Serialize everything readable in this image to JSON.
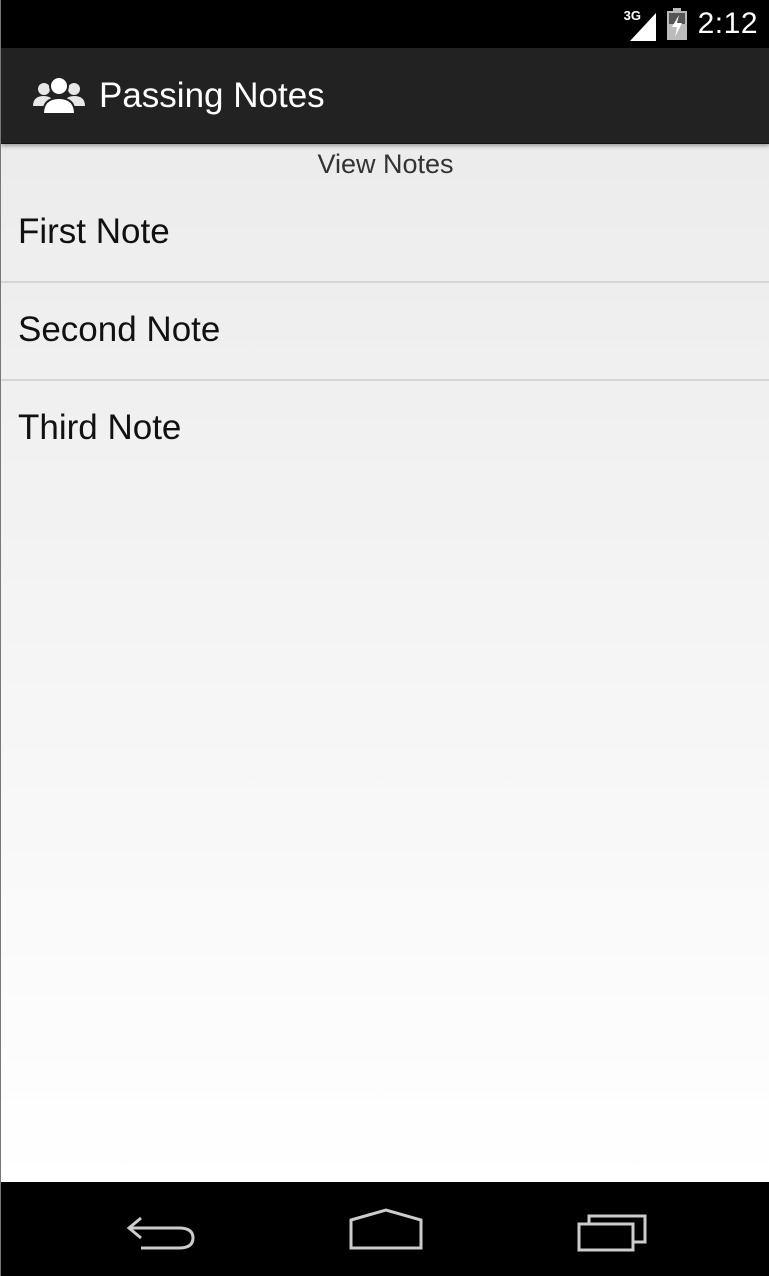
{
  "status_bar": {
    "network_type": "3G",
    "time": "2:12",
    "icons": [
      "signal-icon",
      "battery-charging-icon"
    ]
  },
  "action_bar": {
    "title": "Passing Notes",
    "app_icon": "people-icon"
  },
  "content": {
    "section_header": "View Notes",
    "notes": [
      {
        "label": "First Note"
      },
      {
        "label": "Second Note"
      },
      {
        "label": "Third Note"
      }
    ]
  },
  "nav_bar": {
    "buttons": [
      "back-icon",
      "home-icon",
      "recents-icon"
    ]
  },
  "colors": {
    "status_bar_bg": "#000000",
    "action_bar_bg": "#222222",
    "divider": "#d5d5d5",
    "nav_bar_bg": "#000000"
  }
}
